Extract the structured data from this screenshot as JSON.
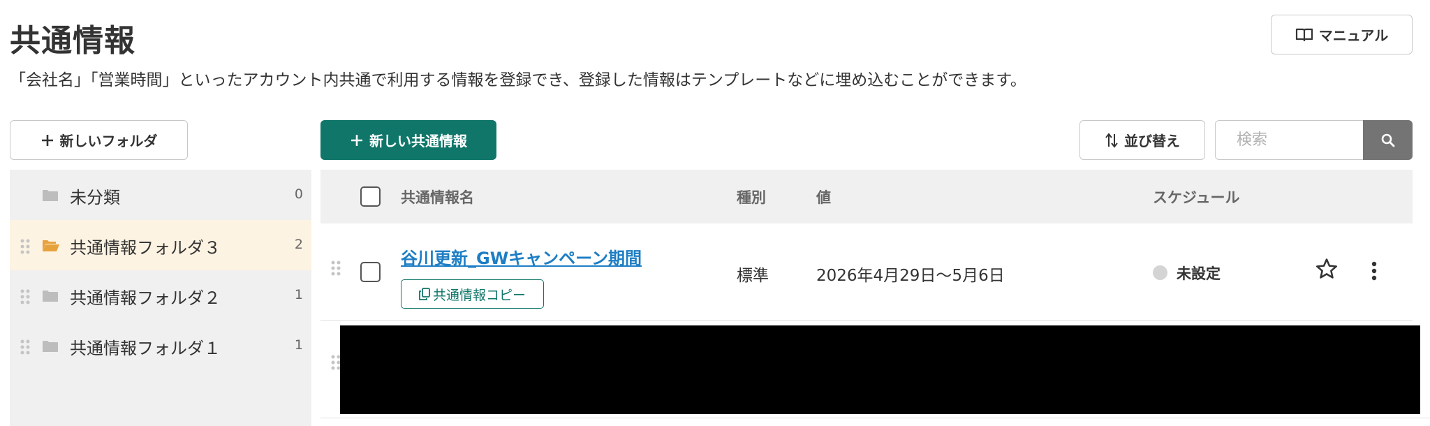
{
  "header": {
    "title": "共通情報",
    "description": "「会社名」「営業時間」といったアカウント内共通で利用する情報を登録でき、登録した情報はテンプレートなどに埋め込むことができます。",
    "manual_label": "マニュアル"
  },
  "toolbar": {
    "new_folder_label": "新しいフォルダ",
    "new_info_label": "新しい共通情報",
    "sort_label": "並び替え",
    "search_placeholder": "検索"
  },
  "sidebar": {
    "folders": [
      {
        "label": "未分類",
        "count": "0"
      },
      {
        "label": "共通情報フォルダ３",
        "count": "2"
      },
      {
        "label": "共通情報フォルダ２",
        "count": "1"
      },
      {
        "label": "共通情報フォルダ１",
        "count": "1"
      }
    ]
  },
  "table": {
    "headers": {
      "name": "共通情報名",
      "type": "種別",
      "value": "値",
      "schedule": "スケジュール"
    },
    "rows": [
      {
        "name": "谷川更新_GWキャンペーン期間",
        "copy_label": "共通情報コピー",
        "type": "標準",
        "value": "2026年4月29日〜5月6日",
        "schedule": "未設定"
      }
    ]
  },
  "colors": {
    "primary": "#0f7669",
    "link": "#1d7ec4",
    "active_folder_bg": "#fdf3e2",
    "folder_open_icon": "#e6a23c"
  }
}
